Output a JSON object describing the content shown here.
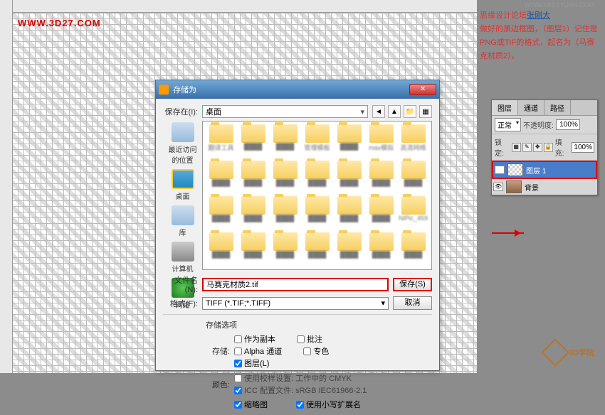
{
  "watermark_main": "WWW.3D27.COM",
  "watermark_side": "WWW.MISSYUAN.COM",
  "annotation": {
    "prefix": "思缘设计论坛",
    "link": "张刚大",
    "body": "做好的黑边框图，（图层1）记住是PNG或TIF的格式，起名为（马赛克材质2）。"
  },
  "dialog": {
    "title": "存储为",
    "savein_label": "保存在(I):",
    "savein_value": "桌面",
    "places": {
      "recent": "最近访问的位置",
      "desktop": "桌面",
      "library": "库",
      "computer": "计算机",
      "network": "网络"
    },
    "folders": [
      "翻译工具",
      "",
      "",
      "管理模板文件",
      "",
      "max模拟",
      "高清网络大图",
      "",
      "",
      "",
      "",
      "",
      "",
      "",
      "",
      "",
      "",
      "",
      "",
      "",
      "NiPic_459",
      "",
      "",
      "",
      "",
      "",
      "",
      ""
    ],
    "filename_label": "文件名(N):",
    "filename_value": "马赛克材质2.tif",
    "format_label": "格式(F):",
    "format_value": "TIFF (*.TIF;*.TIFF)",
    "save_btn": "保存(S)",
    "cancel_btn": "取消",
    "options": {
      "title": "存储选项",
      "save_label": "存储:",
      "as_copy": "作为副本",
      "notes": "批注",
      "alpha": "Alpha 通道",
      "spot": "专色",
      "layers": "图层(L)",
      "color_label": "颜色:",
      "proof": "使用校样设置: 工作中的 CMYK",
      "icc": "ICC 配置文件: sRGB IEC61966-2.1",
      "thumbnail": "缩略图",
      "lowercase": "使用小写扩展名"
    }
  },
  "layers": {
    "tabs": {
      "layers": "图层",
      "channels": "通道",
      "paths": "路径"
    },
    "blend": "正常",
    "opacity_label": "不透明度:",
    "opacity_value": "100%",
    "lock_label": "锁定:",
    "fill_label": "填充:",
    "fill_value": "100%",
    "layer1": "图层 1",
    "background": "背景"
  },
  "logo3d": "3D学院"
}
